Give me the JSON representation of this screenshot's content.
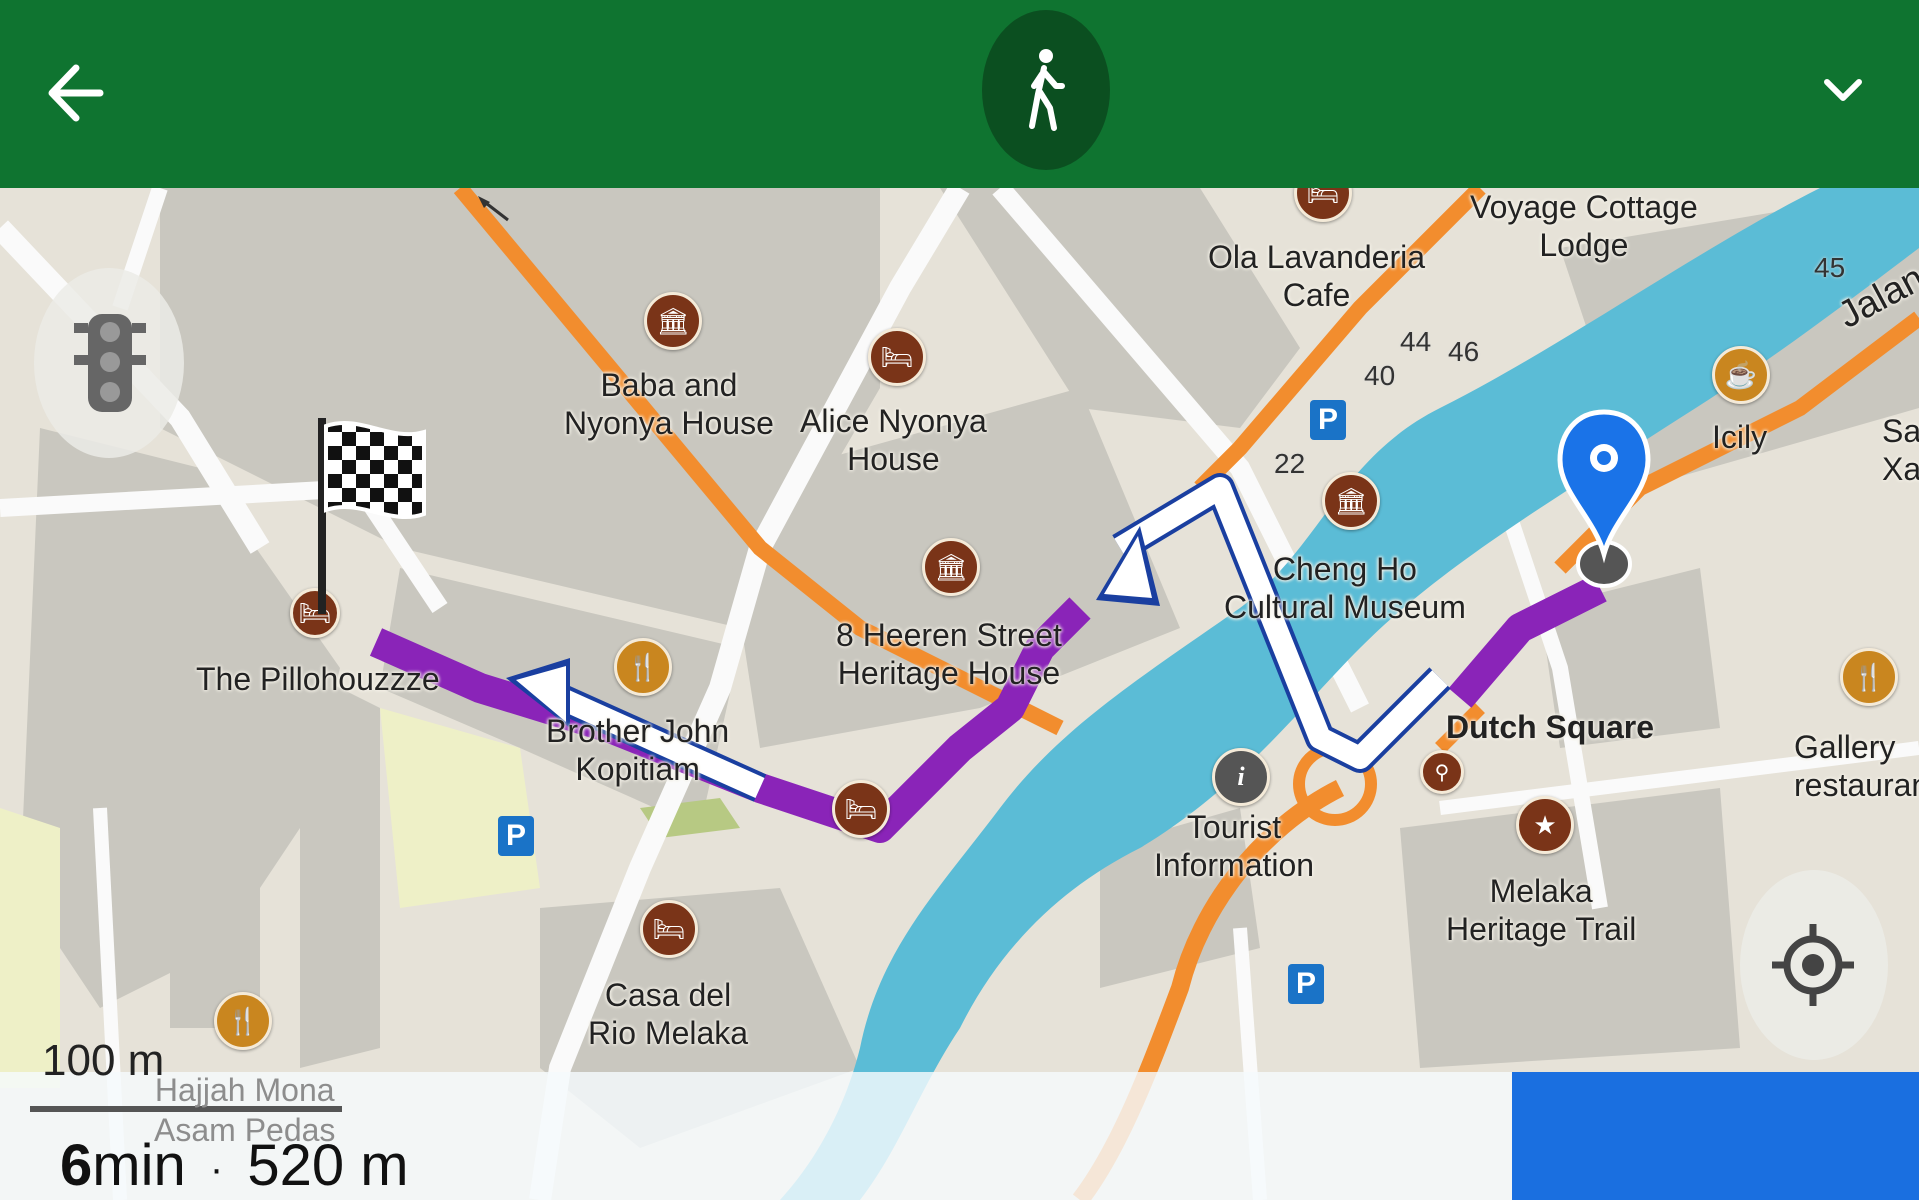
{
  "header": {
    "back_icon": "arrow-left-icon",
    "mode_icon": "walking-person-icon",
    "collapse_icon": "chevron-down-icon",
    "bar_color": "#0f7430"
  },
  "map": {
    "labels": {
      "voyage": "Voyage Cottage\nLodge",
      "ola": "Ola Lavanderia\nCafe",
      "baba": "Baba and\nNyonya House",
      "alice": "Alice Nyonya\nHouse",
      "heeren": "8 Heeren Street\nHeritage House",
      "cheng": "Cheng Ho\nCultural Museum",
      "pillo": "The Pillohouzzze",
      "brother": "Brother John\nKopitiam",
      "dutch": "Dutch Square",
      "tourist": "Tourist\nInformation",
      "melaka": "Melaka\nHeritage Trail",
      "casa": "Casa del\nRio Melaka",
      "icily": "Icily",
      "gallery": "Gallery\nrestaurant",
      "jalan": "Jalan",
      "sa": "Sa\nXa",
      "hajjah": "Hajjah Mona\nAsam Pedas"
    },
    "numbers": [
      "45",
      "44",
      "46",
      "40",
      "22"
    ],
    "route_color": "#8a24b8",
    "river_color": "#5bbcd6"
  },
  "controls": {
    "traffic_icon": "traffic-light-icon",
    "locate_icon": "crosshair-location-icon"
  },
  "bottom": {
    "scale": "100 m",
    "duration_value": "6",
    "duration_unit": "min",
    "separator": "·",
    "distance": "520 m"
  }
}
